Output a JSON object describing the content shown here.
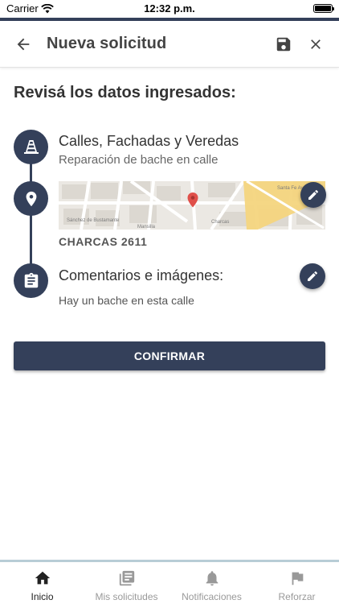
{
  "status_bar": {
    "carrier": "Carrier",
    "time": "12:32 p.m."
  },
  "app_bar": {
    "title": "Nueva solicitud"
  },
  "review": {
    "heading": "Revisá los datos ingresados:",
    "category": {
      "title": "Calles, Fachadas y Veredas",
      "subtitle": "Reparación de bache en calle",
      "icon": "traffic-cone-icon"
    },
    "location": {
      "address": "CHARCAS 2611",
      "icon": "location-pin-icon",
      "map_labels": [
        "Santa Fe Av",
        "Charcas",
        "Mansilla",
        "Sánchez de Bustamante"
      ]
    },
    "comments": {
      "title": "Comentarios e imágenes:",
      "text": "Hay un bache en esta calle",
      "icon": "clipboard-icon"
    }
  },
  "confirm_button": {
    "label": "CONFIRMAR"
  },
  "tab_bar": {
    "tabs": [
      {
        "label": "Inicio",
        "icon": "home-icon",
        "active": true
      },
      {
        "label": "Mis solicitudes",
        "icon": "list-icon",
        "active": false
      },
      {
        "label": "Notificaciones",
        "icon": "bell-icon",
        "active": false
      },
      {
        "label": "Reforzar",
        "icon": "flag-icon",
        "active": false
      }
    ]
  },
  "colors": {
    "primary": "#34405a",
    "tab_border": "#b8cdd6",
    "map_pin": "#e0504a",
    "map_road_major": "#f4d57e"
  }
}
